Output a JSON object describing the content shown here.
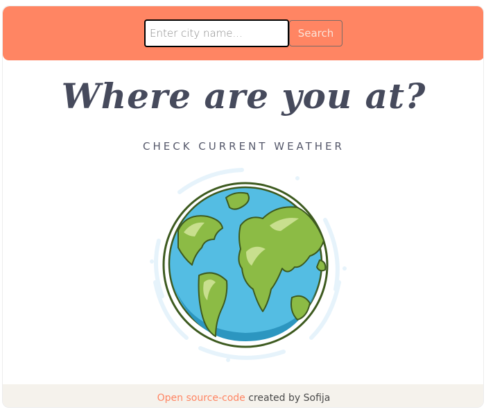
{
  "search": {
    "placeholder": "Enter city name...",
    "value": "",
    "button_label": "Search"
  },
  "main": {
    "title": "Where are you at?",
    "subtitle": "CHECK CURRENT WEATHER",
    "illustration": "globe-icon"
  },
  "footer": {
    "link_text": "Open source-code",
    "credit_text": " created by Sofija"
  },
  "colors": {
    "accent": "#ff8563",
    "title": "#464a5c",
    "footer_bg": "#f5f2ec",
    "ocean": "#54bde3",
    "land": "#8cbb45",
    "outline": "#3d5a1f"
  }
}
